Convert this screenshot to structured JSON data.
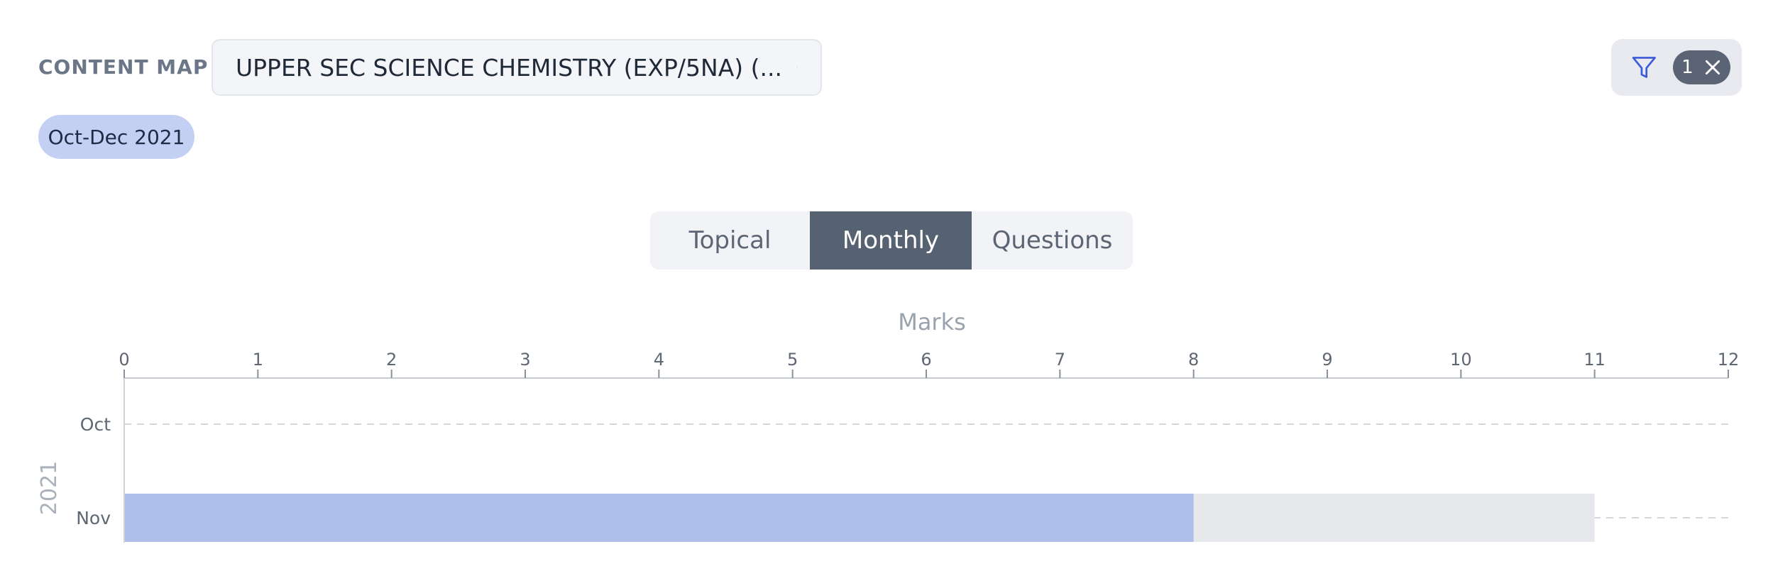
{
  "header": {
    "content_map_label": "CONTENT MAP",
    "content_map_value": "UPPER SEC SCIENCE CHEMISTRY (EXP/5NA) (..."
  },
  "filter": {
    "active_count": "1"
  },
  "date_chip": "Oct-Dec 2021",
  "tabs": [
    {
      "label": "Topical",
      "selected": false
    },
    {
      "label": "Monthly",
      "selected": true
    },
    {
      "label": "Questions",
      "selected": false
    }
  ],
  "colors": {
    "score_bar": "#aebfea",
    "total_bar": "#e7e8ec",
    "active_tab": "#566271",
    "chevron": "#3b5bdb",
    "filter_icon": "#3b5bdb"
  },
  "chart_data": {
    "type": "bar",
    "orientation": "horizontal",
    "title": "Marks",
    "xlabel": "",
    "ylabel": "2021",
    "xlim": [
      0,
      12
    ],
    "x_ticks": [
      0,
      1,
      2,
      3,
      4,
      5,
      6,
      7,
      8,
      9,
      10,
      11,
      12
    ],
    "categories": [
      "Oct",
      "Nov"
    ],
    "series": [
      {
        "values": [
          null,
          11
        ],
        "role": "total"
      },
      {
        "values": [
          null,
          8
        ],
        "role": "score"
      }
    ],
    "grid": "dashed horizontal at categories"
  }
}
